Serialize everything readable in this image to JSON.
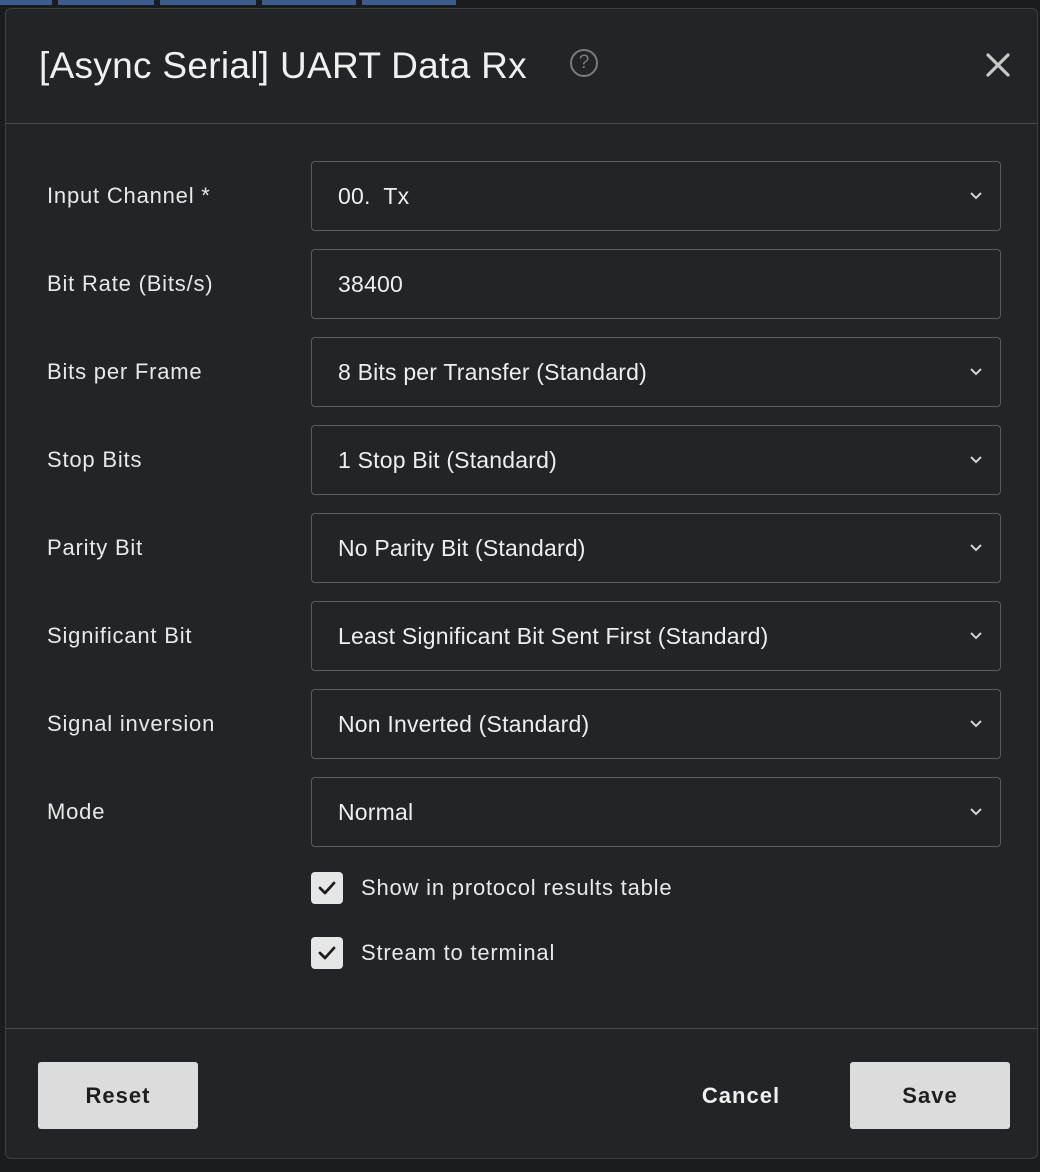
{
  "dialog": {
    "title": "[Async Serial] UART Data Rx",
    "help_icon": "help-circle-icon",
    "close_icon": "close-icon"
  },
  "fields": [
    {
      "label": "Input Channel *",
      "value": "00.  Tx",
      "type": "select"
    },
    {
      "label": "Bit Rate (Bits/s)",
      "value": "38400",
      "type": "text"
    },
    {
      "label": "Bits per Frame",
      "value": "8 Bits per Transfer (Standard)",
      "type": "select"
    },
    {
      "label": "Stop Bits",
      "value": "1 Stop Bit (Standard)",
      "type": "select"
    },
    {
      "label": "Parity Bit",
      "value": "No Parity Bit (Standard)",
      "type": "select"
    },
    {
      "label": "Significant Bit",
      "value": "Least Significant Bit Sent First (Standard)",
      "type": "select"
    },
    {
      "label": "Signal inversion",
      "value": "Non Inverted (Standard)",
      "type": "select"
    },
    {
      "label": "Mode",
      "value": "Normal",
      "type": "select"
    }
  ],
  "checkboxes": [
    {
      "label": "Show in protocol results table",
      "checked": true
    },
    {
      "label": "Stream to terminal",
      "checked": true
    }
  ],
  "footer": {
    "reset_label": "Reset",
    "cancel_label": "Cancel",
    "save_label": "Save"
  }
}
